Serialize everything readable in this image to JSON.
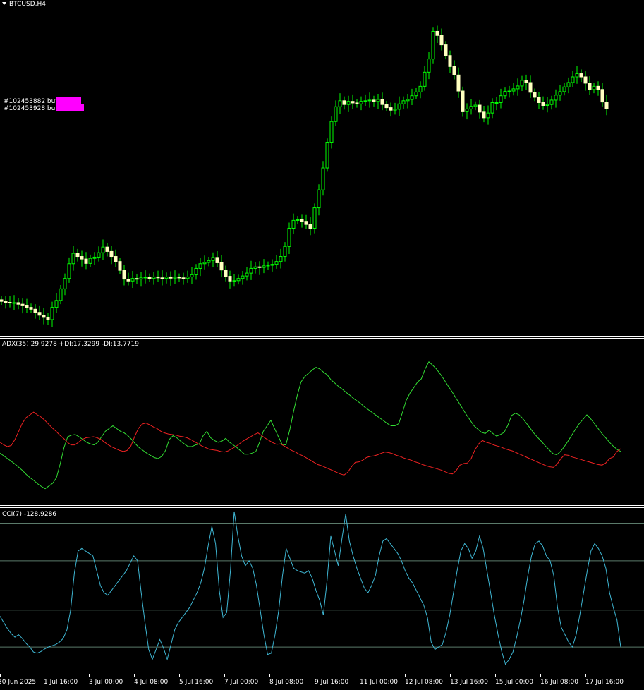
{
  "window": {
    "symbol_label": "BTCUSD,H4"
  },
  "orders": [
    {
      "label": "#102453882 buy"
    },
    {
      "label": "#102453928 buy"
    }
  ],
  "indicators": {
    "adx_label": "ADX(35) 29.9278 +DI:17.3299 -DI:13.7719",
    "cci_label": "CCI(7) -128.9286"
  },
  "colors": {
    "background": "#000000",
    "bull_candle": "#ffffc0",
    "candle_wick": "#00ff00",
    "order_line": "#7fcf9f",
    "order_marker": "#ff00ff",
    "plus_di": "#33dd33",
    "minus_di": "#ee2222",
    "cci": "#3fb7d4",
    "separator": "#ffffff",
    "level_line": "#5a7a6a"
  },
  "chart_data": [
    {
      "type": "candlestick",
      "title": "BTCUSD,H4",
      "x_tick_labels": [
        "30 Jun 2025",
        "1 Jul 16:00",
        "3 Jul 00:00",
        "4 Jul 08:00",
        "5 Jul 16:00",
        "7 Jul 00:00",
        "8 Jul 08:00",
        "9 Jul 16:00",
        "11 Jul 00:00",
        "12 Jul 08:00",
        "13 Jul 16:00",
        "15 Jul 00:00",
        "16 Jul 08:00",
        "17 Jul 16:00"
      ],
      "bars": 147,
      "close": [
        0.085,
        0.082,
        0.08,
        0.081,
        0.076,
        0.071,
        0.066,
        0.06,
        0.05,
        0.041,
        0.034,
        0.027,
        0.066,
        0.088,
        0.125,
        0.158,
        0.205,
        0.238,
        0.228,
        0.22,
        0.206,
        0.222,
        0.226,
        0.24,
        0.258,
        0.244,
        0.228,
        0.212,
        0.184,
        0.156,
        0.15,
        0.158,
        0.156,
        0.16,
        0.162,
        0.158,
        0.163,
        0.16,
        0.158,
        0.163,
        0.159,
        0.162,
        0.16,
        0.158,
        0.163,
        0.17,
        0.19,
        0.205,
        0.209,
        0.215,
        0.225,
        0.208,
        0.185,
        0.165,
        0.15,
        0.151,
        0.158,
        0.166,
        0.175,
        0.19,
        0.195,
        0.193,
        0.198,
        0.2,
        0.203,
        0.212,
        0.228,
        0.26,
        0.318,
        0.343,
        0.345,
        0.34,
        0.33,
        0.318,
        0.383,
        0.44,
        0.51,
        0.592,
        0.658,
        0.705,
        0.724,
        0.712,
        0.722,
        0.717,
        0.714,
        0.722,
        0.724,
        0.726,
        0.722,
        0.728,
        0.712,
        0.702,
        0.694,
        0.697,
        0.714,
        0.724,
        0.728,
        0.74,
        0.752,
        0.77,
        0.815,
        0.857,
        0.945,
        0.932,
        0.902,
        0.868,
        0.833,
        0.806,
        0.755,
        0.689,
        0.698,
        0.706,
        0.71,
        0.688,
        0.67,
        0.685,
        0.718,
        0.718,
        0.74,
        0.754,
        0.755,
        0.762,
        0.771,
        0.789,
        0.782,
        0.751,
        0.735,
        0.718,
        0.709,
        0.712,
        0.726,
        0.742,
        0.753,
        0.768,
        0.782,
        0.8,
        0.81,
        0.8,
        0.78,
        0.76,
        0.77,
        0.76,
        0.72,
        0.7
      ],
      "low": 0.02,
      "high": 0.96
    },
    {
      "type": "line",
      "title": "ADX(35) 29.9278 +DI:17.3299 -DI:13.7719",
      "series": [
        {
          "name": "+DI",
          "values": [
            17,
            16.5,
            16,
            15.5,
            15,
            14.4,
            13.8,
            13.1,
            12.5,
            12,
            11.4,
            10.9,
            10.5,
            11,
            11.5,
            12.5,
            15,
            18,
            20,
            20.3,
            20.4,
            20,
            19.5,
            19,
            18.7,
            18.5,
            19,
            20,
            21,
            21.5,
            22,
            21.5,
            21,
            20.7,
            20.2,
            19.5,
            18.7,
            18,
            17.5,
            17,
            16.6,
            16.2,
            16,
            16.4,
            17.5,
            19.5,
            20.2,
            19.8,
            19.2,
            18.7,
            18.2,
            18.2,
            18.5,
            18.7,
            20.2,
            21,
            19.8,
            19.3,
            19,
            19.2,
            19.7,
            19,
            18.5,
            18,
            17.4,
            16.8,
            16.8,
            17,
            17.3,
            19,
            21,
            22,
            23,
            21.5,
            20,
            18.6,
            18.5,
            21.2,
            24.5,
            27.5,
            30,
            31,
            31.6,
            32.2,
            32.7,
            32.4,
            31.8,
            31.3,
            30.4,
            29.8,
            29.2,
            28.7,
            28.1,
            27.6,
            27,
            26.5,
            26,
            25.4,
            24.9,
            24.4,
            23.9,
            23.4,
            22.9,
            22.4,
            22,
            22,
            22.4,
            24.5,
            26.7,
            28,
            29,
            30,
            30.6,
            32.4,
            33.7,
            33.1,
            32.4,
            31.5,
            30.5,
            29.4,
            28.4,
            27.3,
            26.2,
            25.1,
            24,
            23,
            22,
            21.4,
            20.8,
            20.6,
            21.2,
            20.6,
            20.1,
            20.4,
            20.8,
            22.1,
            23.9,
            24.3,
            24,
            23.3,
            22.4,
            21.5,
            20.6,
            19.8,
            19.1,
            18.3,
            17.6,
            16.9,
            16.7,
            17.3,
            18.2,
            19.2,
            20.3,
            21.4,
            22.4,
            23.2,
            24,
            23.3,
            22.4,
            21.5,
            20.6,
            19.8,
            19,
            18.3,
            17.7,
            17.3
          ]
        },
        {
          "name": "-DI",
          "values": [
            19,
            18.5,
            18.2,
            18.4,
            19.5,
            21,
            22.5,
            23.5,
            24,
            24.5,
            24,
            23.6,
            23,
            22.3,
            21.6,
            21,
            20.3,
            19.7,
            19,
            18.5,
            18.5,
            19,
            19.5,
            19.8,
            19.9,
            20,
            19.8,
            19.5,
            19,
            18.5,
            18.1,
            17.8,
            17.5,
            17.3,
            17.5,
            18.3,
            20,
            21.5,
            22.3,
            22.5,
            22.2,
            21.8,
            21.5,
            21,
            20.7,
            20.5,
            20.4,
            20.3,
            20.1,
            20,
            19.8,
            19.5,
            19.1,
            18.7,
            18.3,
            18,
            17.7,
            17.6,
            17.5,
            17.3,
            17.2,
            17.4,
            17.8,
            18.2,
            18.7,
            19.2,
            19.6,
            20,
            20.4,
            20.7,
            20.2,
            19.7,
            19.3,
            18.9,
            18.6,
            18.7,
            18.3,
            17.9,
            17.5,
            17.2,
            16.8,
            16.5,
            16.1,
            15.7,
            15.3,
            14.9,
            14.7,
            14.4,
            14.1,
            13.8,
            13.5,
            13.2,
            13,
            13.5,
            14.5,
            15.3,
            15.4,
            15.7,
            16.2,
            16.4,
            16.5,
            16.7,
            17,
            17.2,
            17.1,
            16.9,
            16.6,
            16.4,
            16.1,
            15.9,
            15.7,
            15.4,
            15.2,
            14.9,
            14.7,
            14.5,
            14.3,
            14.1,
            13.9,
            13.6,
            13.3,
            13.2,
            13.8,
            14.8,
            15.1,
            15.2,
            16,
            17.6,
            18.7,
            19.3,
            19,
            18.8,
            18.5,
            18.3,
            18.1,
            17.8,
            17.6,
            17.4,
            17.1,
            16.8,
            16.5,
            16.2,
            15.9,
            15.6,
            15.3,
            15,
            14.7,
            14.5,
            14.4,
            15,
            16,
            16.7,
            16.6,
            16.3,
            16.1,
            15.9,
            15.7,
            15.5,
            15.3,
            15.1,
            14.9,
            14.8,
            15.2,
            16,
            16.3,
            17.3,
            17.8
          ]
        }
      ]
    },
    {
      "type": "line",
      "title": "CCI(7) -128.9286",
      "levels": [
        250,
        100,
        -100,
        -250
      ],
      "ylim": [
        -350,
        300
      ],
      "series": [
        {
          "name": "CCI",
          "values": [
            -125,
            -150,
            -175,
            -195,
            -210,
            -200,
            -215,
            -235,
            -250,
            -270,
            -275,
            -268,
            -258,
            -250,
            -245,
            -240,
            -230,
            -215,
            -180,
            -100,
            50,
            140,
            150,
            140,
            130,
            120,
            60,
            0,
            -30,
            -40,
            -20,
            0,
            20,
            40,
            60,
            90,
            120,
            100,
            -30,
            -150,
            -260,
            -300,
            -260,
            -220,
            -255,
            -300,
            -240,
            -180,
            -150,
            -130,
            -110,
            -90,
            -60,
            -30,
            10,
            70,
            160,
            240,
            170,
            -20,
            -130,
            -110,
            60,
            300,
            200,
            120,
            80,
            100,
            70,
            0,
            -100,
            -200,
            -280,
            -275,
            -200,
            -100,
            40,
            150,
            110,
            70,
            60,
            55,
            50,
            60,
            30,
            -20,
            -60,
            -120,
            20,
            200,
            140,
            80,
            190,
            290,
            180,
            120,
            70,
            30,
            -10,
            -30,
            0,
            40,
            120,
            180,
            190,
            170,
            150,
            130,
            100,
            60,
            30,
            10,
            -20,
            -50,
            -80,
            -130,
            -230,
            -260,
            -250,
            -240,
            -190,
            -120,
            -30,
            60,
            140,
            170,
            150,
            110,
            140,
            200,
            150,
            60,
            -30,
            -120,
            -200,
            -270,
            -320,
            -300,
            -270,
            -210,
            -140,
            -60,
            40,
            120,
            170,
            180,
            160,
            120,
            100,
            40,
            -90,
            -170,
            -200,
            -230,
            -250,
            -200,
            -120,
            -30,
            60,
            140,
            170,
            150,
            120,
            70,
            -30,
            -90,
            -140,
            -250
          ]
        }
      ]
    }
  ]
}
